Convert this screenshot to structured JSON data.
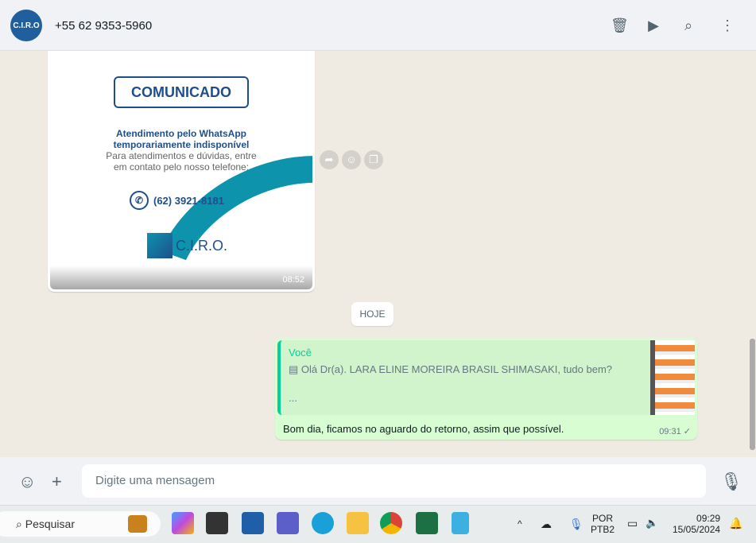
{
  "header": {
    "avatar_text": "C.I.R.O",
    "contact": "+55 62 9353-5960",
    "icons": [
      "trash-icon",
      "label-icon",
      "search-icon",
      "menu-icon"
    ]
  },
  "chat": {
    "image_message": {
      "badge": "COMUNICADO",
      "line1": "Atendimento pelo WhatsApp",
      "line2": "temporariamente indisponível",
      "line3": "Para atendimentos e dúvidas, entre",
      "line4": "em contato pelo nosso telefone:",
      "phone": "(62) 3921-8181",
      "logo": "C.I.R.O.",
      "time": "08:52"
    },
    "day_divider": "HOJE",
    "outgoing": {
      "quote_author": "Você",
      "quote_text": "Olá Dr(a). LARA ELINE MOREIRA BRASIL SHIMASAKI, tudo bem?",
      "quote_more": "...",
      "text": "Bom dia, ficamos no aguardo do retorno, assim que possível.",
      "time": "09:31",
      "status": "sent"
    }
  },
  "composer": {
    "placeholder": "Digite uma mensagem"
  },
  "taskbar": {
    "search": "Pesquisar",
    "lang1": "POR",
    "lang2": "PTB2",
    "time": "09:29",
    "date": "15/05/2024"
  }
}
